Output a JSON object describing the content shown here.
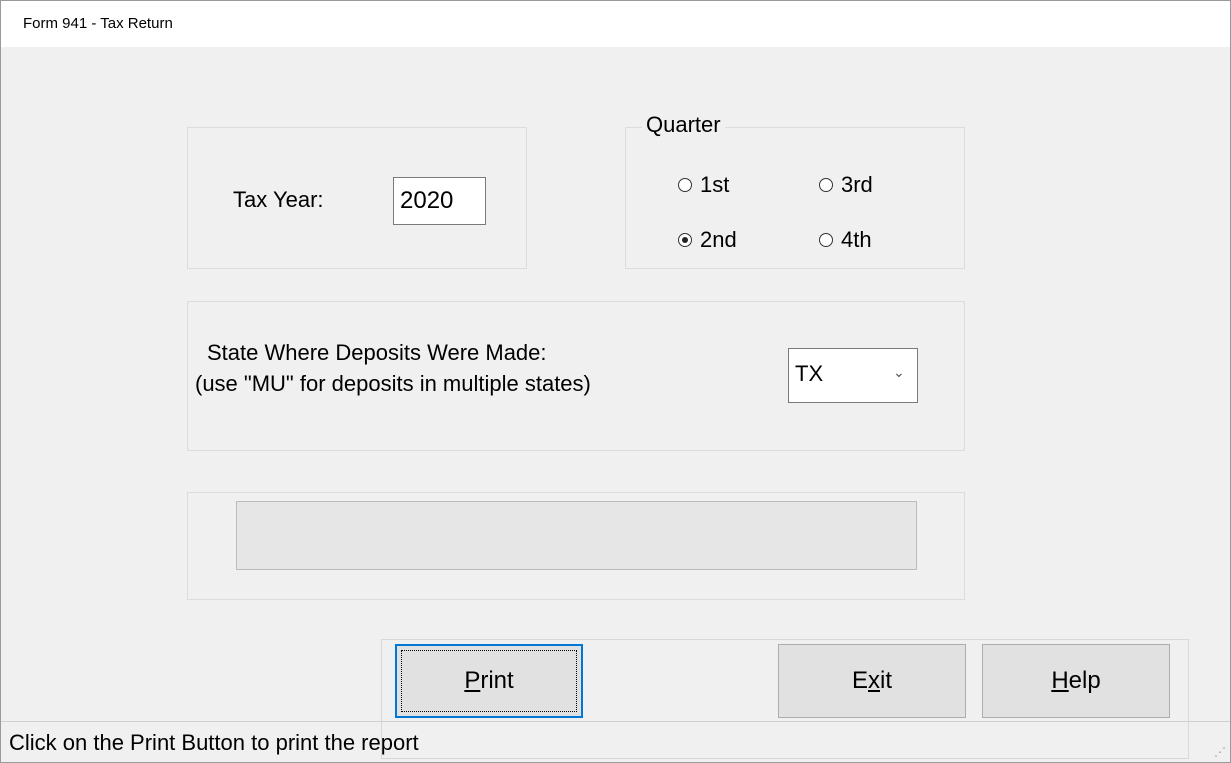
{
  "window": {
    "title": "Form 941 - Tax Return"
  },
  "tax_year": {
    "label": "Tax Year:",
    "value": "2020"
  },
  "quarter": {
    "legend": "Quarter",
    "options": [
      {
        "label": "1st",
        "checked": false
      },
      {
        "label": "3rd",
        "checked": false
      },
      {
        "label": "2nd",
        "checked": true
      },
      {
        "label": "4th",
        "checked": false
      }
    ]
  },
  "state": {
    "label_line1": "State Where Deposits Were Made:",
    "label_line2": "(use \"MU\" for deposits in multiple states)",
    "selected": "TX"
  },
  "buttons": {
    "print": {
      "before": "",
      "accel": "P",
      "after": "rint"
    },
    "exit": {
      "before": "E",
      "accel": "x",
      "after": "it"
    },
    "help": {
      "before": "",
      "accel": "H",
      "after": "elp"
    }
  },
  "status": {
    "text": "Click on the Print Button to print the report"
  },
  "icons": {
    "dropdown": "chevron-down-icon",
    "grip": "resize-grip-icon"
  }
}
